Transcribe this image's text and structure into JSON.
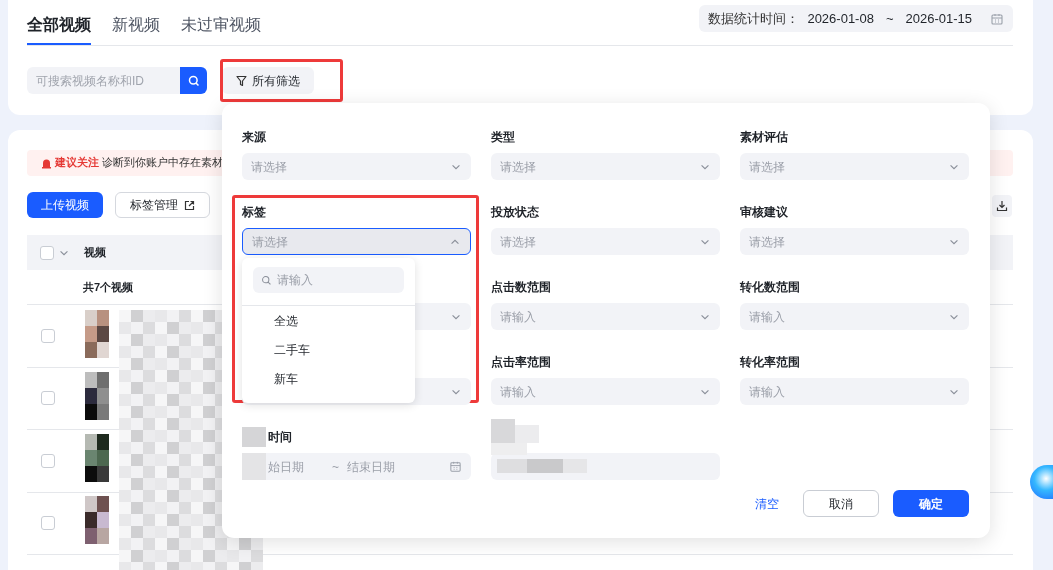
{
  "tabs": [
    {
      "label": "全部视频",
      "selected": true
    },
    {
      "label": "新视频",
      "selected": false
    },
    {
      "label": "未过审视频",
      "selected": false
    }
  ],
  "date_range": {
    "label": "数据统计时间：",
    "start": "2026-01-08",
    "separator": "~",
    "end": "2026-01-15"
  },
  "search": {
    "placeholder": "可搜索视频名称和ID"
  },
  "filter_button": {
    "label": "所有筛选",
    "highlighted": true
  },
  "alert": {
    "tag": "建议关注",
    "text": "诊断到你账户中存在素材"
  },
  "toolbar": {
    "buttons": [
      {
        "label": "上传视频",
        "kind": "primary"
      },
      {
        "label": "标签管理",
        "kind": "external"
      }
    ]
  },
  "table": {
    "select_all": {
      "checked": false
    },
    "columns": [
      "视频"
    ],
    "summary": "共7个视频",
    "rows": [
      {
        "checked": false
      },
      {
        "checked": false
      },
      {
        "checked": false
      },
      {
        "checked": false
      }
    ]
  },
  "filter_panel": {
    "fields": [
      {
        "kind": "select",
        "label": "来源",
        "placeholder": "请选择",
        "open": false,
        "highlighted": false
      },
      {
        "kind": "select",
        "label": "类型",
        "placeholder": "请选择",
        "open": false,
        "highlighted": false
      },
      {
        "kind": "select",
        "label": "素材评估",
        "placeholder": "请选择",
        "open": false,
        "highlighted": false
      },
      {
        "kind": "select",
        "label": "标签",
        "placeholder": "请选择",
        "open": true,
        "highlighted": true
      },
      {
        "kind": "select",
        "label": "投放状态",
        "placeholder": "请选择",
        "open": false,
        "highlighted": false
      },
      {
        "kind": "select",
        "label": "审核建议",
        "placeholder": "请选择",
        "open": false,
        "highlighted": false
      },
      {
        "kind": "select",
        "open": false,
        "highlighted": false
      },
      {
        "kind": "select",
        "label": "点击数范围",
        "placeholder": "请输入",
        "open": false,
        "highlighted": false
      },
      {
        "kind": "select",
        "label": "转化数范围",
        "placeholder": "请输入",
        "open": false,
        "highlighted": false
      },
      {
        "kind": "select",
        "open": false,
        "highlighted": false
      },
      {
        "kind": "select",
        "label": "点击率范围",
        "placeholder": "请输入",
        "open": false,
        "highlighted": false
      },
      {
        "kind": "select",
        "label": "转化率范围",
        "placeholder": "请输入",
        "open": false,
        "highlighted": false
      },
      {
        "kind": "date_range",
        "label": "时间",
        "start_placeholder": "始日期",
        "separator": "~",
        "end_placeholder": "结束日期"
      },
      {
        "kind": "redacted"
      }
    ],
    "dropdown": {
      "search_placeholder": "请输入",
      "options": [
        "全选",
        "二手车",
        "新车"
      ]
    },
    "actions": [
      {
        "label": "清空",
        "kind": "link"
      },
      {
        "label": "取消",
        "kind": "secondary"
      },
      {
        "label": "确定",
        "kind": "primary"
      }
    ]
  }
}
